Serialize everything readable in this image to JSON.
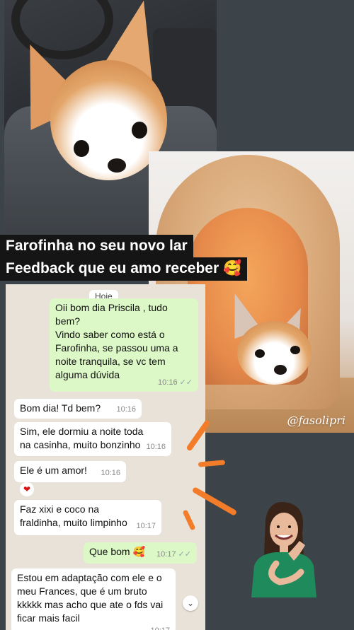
{
  "titles": {
    "line1": "Farofinha no seu novo lar",
    "line2": "Feedback que eu amo receber 🥰"
  },
  "photo_watermark": "@fasolipri",
  "chat": {
    "day_label": "Hoje",
    "messages": [
      {
        "dir": "out",
        "text": "Oii bom dia Priscila , tudo bem?\nVindo saber como está o Farofinha, se passou uma a noite tranquila, se vc tem alguma dúvida",
        "time": "10:16"
      },
      {
        "dir": "in",
        "text": "Bom dia! Td bem?",
        "time": "10:16"
      },
      {
        "dir": "in",
        "text": "Sim, ele dormiu a noite toda na casinha, muito bonzinho",
        "time": "10:16"
      },
      {
        "dir": "in",
        "text": "Ele é um amor!",
        "time": "10:16"
      },
      {
        "dir": "in",
        "text": "Faz xixi e coco na fraldinha, muito limpinho",
        "time": "10:17"
      },
      {
        "dir": "out",
        "text": "Que bom 🥰",
        "time": "10:17"
      },
      {
        "dir": "in",
        "text": "Estou em adaptação com ele e o meu Frances, que é um bruto kkkkk mas acho que ate o fds vai ficar mais facil",
        "time": "10:17"
      }
    ],
    "reaction_icon": "heart-icon",
    "scroll_icon": "chevron-down-icon"
  },
  "colors": {
    "background": "#3d4449",
    "outgoing_bubble": "#dcf8c6",
    "incoming_bubble": "#ffffff",
    "chat_wallpaper": "#e9e2d8",
    "accent_strokes": "#f27c2a"
  }
}
